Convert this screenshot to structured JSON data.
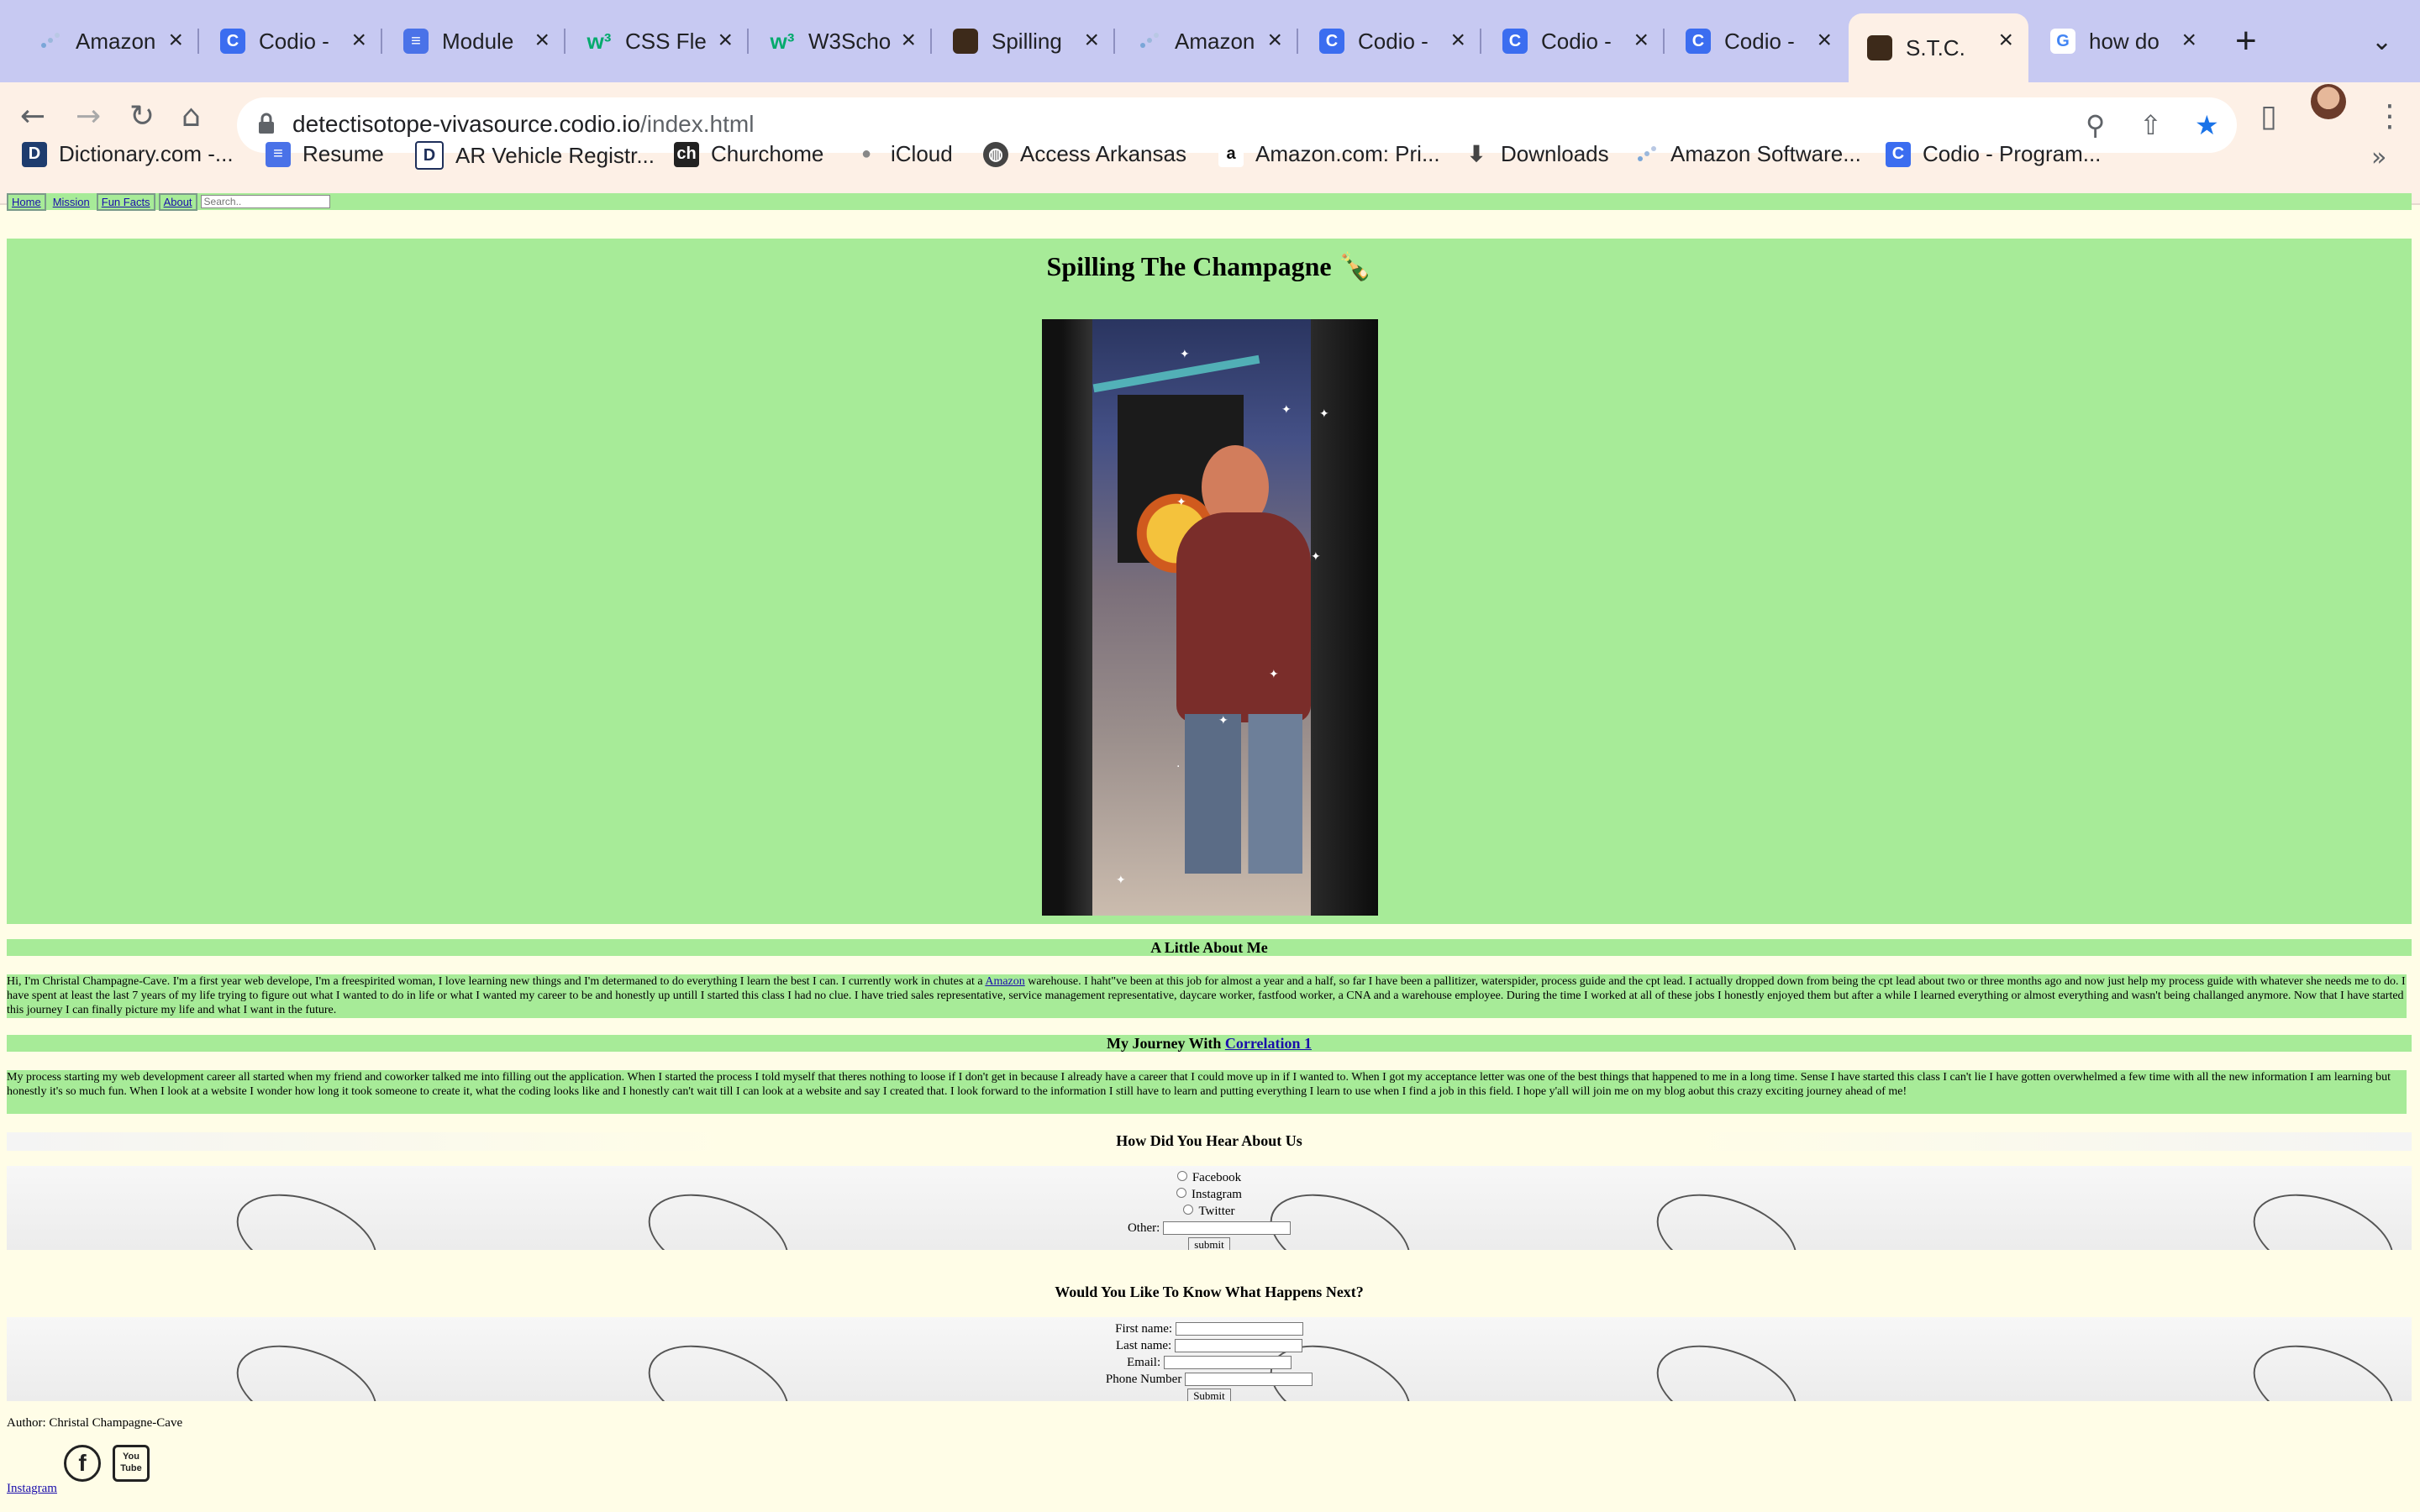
{
  "browser": {
    "tabs": [
      {
        "title": "Amazon",
        "icon": "amazon-software-icon"
      },
      {
        "title": "Codio -",
        "icon": "codio-icon"
      },
      {
        "title": "Module",
        "icon": "docs-icon"
      },
      {
        "title": "CSS Fle",
        "icon": "w3schools-icon"
      },
      {
        "title": "W3Scho",
        "icon": "w3schools-icon"
      },
      {
        "title": "Spilling",
        "icon": "site-icon"
      },
      {
        "title": "Amazon",
        "icon": "amazon-software-icon"
      },
      {
        "title": "Codio -",
        "icon": "codio-icon"
      },
      {
        "title": "Codio -",
        "icon": "codio-icon"
      },
      {
        "title": "Codio -",
        "icon": "codio-icon"
      },
      {
        "title": "S.T.C.",
        "icon": "site-icon"
      },
      {
        "title": "how do",
        "icon": "google-icon"
      }
    ],
    "url_host": "detectisotope-vivasource.codio.io",
    "url_path": "/index.html",
    "bookmarks": [
      "Dictionary.com -...",
      "Resume",
      "AR Vehicle Registr...",
      "Churchome",
      "iCloud",
      "Access Arkansas",
      "Amazon.com: Pri...",
      "Downloads",
      "Amazon Software...",
      "Codio - Program..."
    ],
    "bookmarks_overflow": "»",
    "accent_color": "#c7c9f2"
  },
  "site": {
    "nav": {
      "home": "Home",
      "mission": "Mission",
      "fun_facts": "Fun Facts",
      "about": "About",
      "search_placeholder": "Search.."
    },
    "title": "Spilling The Champagne 🍾",
    "about": {
      "heading": "A Little About Me",
      "text_before": "Hi, I'm Christal Champagne-Cave. I'm a first year web develope, I'm a freespirited woman, I love learning new things and I'm determaned to do everything I learn the best I can. I currently work in chutes at a ",
      "link": "Amazon",
      "text_after": " warehouse. I haht\"ve been at this job for almost a year and a half, so far I have been a pallitizer, waterspider, process guide and the cpt lead. I actually dropped down from being the cpt lead about two or three months ago and now just help my process guide with whatever she needs me to do. I have spent at least the last 7 years of my life trying to figure out what I wanted to do in life or what I wanted my career to be and honestly up untill I started this class I had no clue. I have tried sales representative, service management representative, daycare worker, fastfood worker, a CNA and a warehouse employee. During the time I worked at all of these jobs I honestly enjoyed them but after a while I learned everything or almost everything and wasn't being challanged anymore. Now that I have started this journey I can finally picture my life and what I want in the future."
    },
    "journey": {
      "heading_prefix": "My Journey With ",
      "heading_link": "Correlation 1",
      "text": "My process starting my web development career all started when my friend and coworker talked me into filling out the application. When I started the process I told myself that theres nothing to loose if I don't get in because I already have a career that I could move up in if I wanted to. When I got my acceptance letter was one of the best things that happened to me in a long time. Sense I have started this class I can't lie I have gotten overwhelmed a few time with all the new information I am learning but honestly it's so much fun. When I look at a website I wonder how long it took someone to create it, what the coding looks like and I honestly can't wait till I can look at a website and say I created that. I look forward to the information I still have to learn and putting everything I learn to use when I find a job in this field. I hope y'all will join me on my blog aobut this crazy exciting journey ahead of me!"
    },
    "survey": {
      "heading": "How Did You Hear About Us",
      "options": [
        "Facebook",
        "Instagram",
        "Twitter"
      ],
      "other_label": "Other:",
      "submit": "submit"
    },
    "signup": {
      "heading": "Would You Like To Know What Happens Next?",
      "first_name": "First name:",
      "last_name": "Last name:",
      "email": "Email:",
      "phone": "Phone Number",
      "submit": "Submit"
    },
    "author": "Author: Christal Champagne-Cave",
    "instagram_link": "Instagram",
    "youtube_label": "You Tube",
    "facebook_glyph": "f",
    "page_bg": "#fffde7",
    "band_color": "#a7eb98"
  }
}
